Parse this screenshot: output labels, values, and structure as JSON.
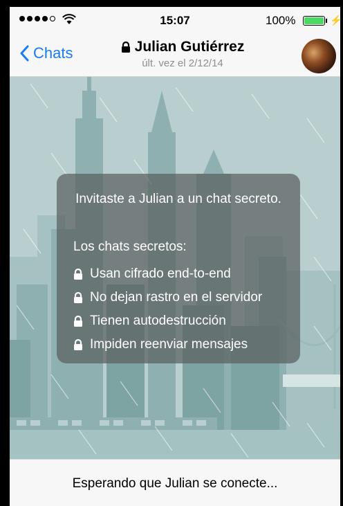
{
  "status_bar": {
    "time": "15:07",
    "battery_percent_label": "100%",
    "battery_level": 1.0,
    "signal_bars": 5,
    "signal_filled": 4
  },
  "nav": {
    "back_label": "Chats",
    "contact_name": "Julian Gutiérrez",
    "last_seen": "últ. vez el 2/12/14",
    "accent_color": "#1a7cf5"
  },
  "secret_chat_info": {
    "heading": "Invitaste a Julian a un chat secreto.",
    "subheading": "Los chats secretos:",
    "features": [
      "Usan cifrado end-to-end",
      "No dejan rastro en el servidor",
      "Tienen autodestrucción",
      "Impiden reenviar mensajes"
    ]
  },
  "footer": {
    "waiting_text": "Esperando que Julian se conecte..."
  },
  "icons": {
    "back": "chevron-left-icon",
    "lock": "lock-icon",
    "wifi": "wifi-icon",
    "battery": "battery-icon",
    "charging": "bolt-icon"
  }
}
